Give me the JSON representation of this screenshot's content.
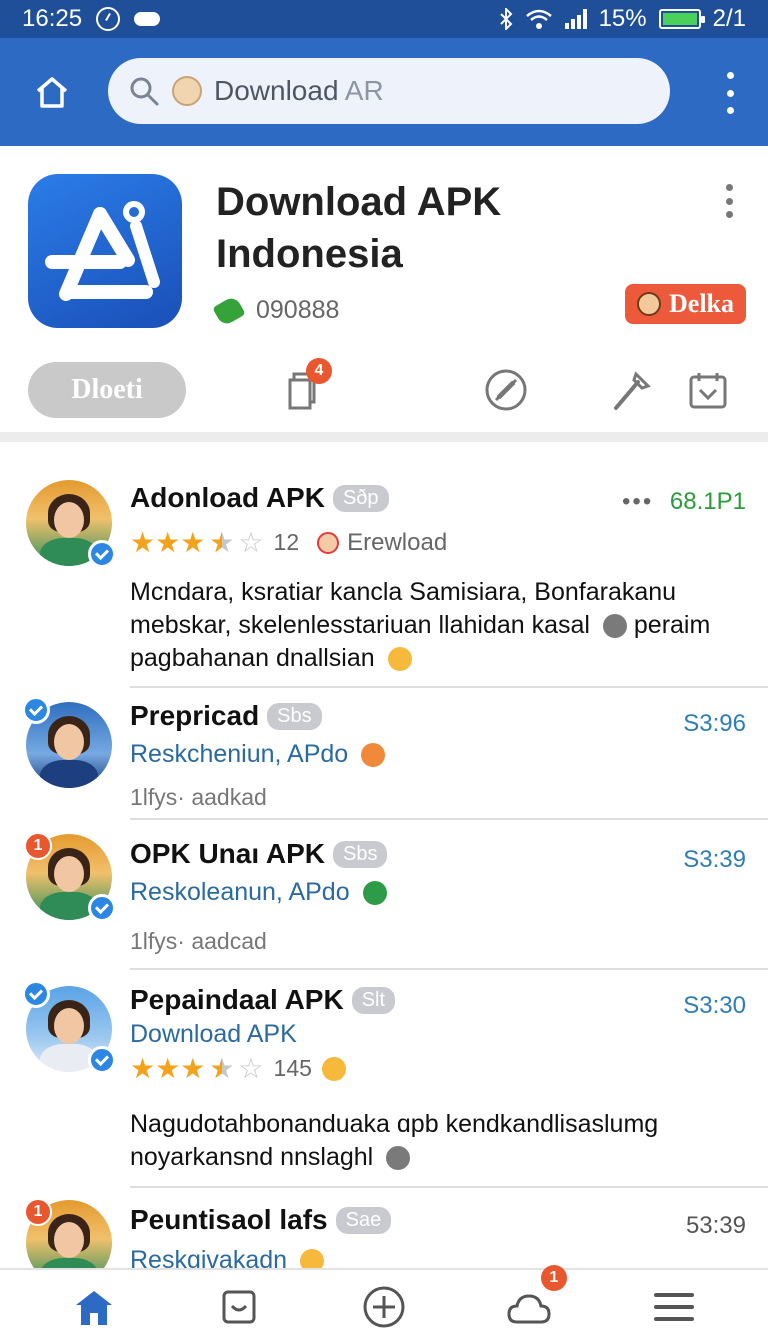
{
  "status_bar": {
    "time": "16:25",
    "battery": "15%",
    "extra": "2/1",
    "battery_color": "#4bd15a"
  },
  "app_bar": {
    "color": "#2d6ac4",
    "search": {
      "query": "Download",
      "suffix": "AR",
      "icon": "search-icon"
    }
  },
  "app": {
    "title": "Download APK Indonesia",
    "downloads": "090888",
    "badge": "Delka",
    "primary_button": "Dloeti",
    "notification_count": "4",
    "logo_color": "#2b7de8"
  },
  "feed": [
    {
      "name": "Adonload APK",
      "tag": "Sðp",
      "time": "68.1P1",
      "rating": 3.5,
      "rating_count": "12",
      "sub_label": "Erewload",
      "body": "Mcndara, ksratiar kancla Samisiara, Bonfarakanu mebskar, skelenlesstariuan llahidan kasal",
      "body_tail": "peraim pagbahanan dnallsian"
    },
    {
      "name": "Prepricad",
      "tag": "Sbs",
      "time": "S3:96",
      "sub": "Reskcheniun, APdo",
      "meta": "1lfys· aadkad"
    },
    {
      "name": "OPK Unaı APK",
      "tag": "Sbs",
      "time": "S3:39",
      "badge_count": "1",
      "sub": "Reskoleanun, APdo",
      "meta": "1lfys· aadcad"
    },
    {
      "name": "Pepaindaal APK",
      "tag": "Slt",
      "time": "S3:30",
      "sub": "Download APK",
      "rating": 3.5,
      "rating_count": "145",
      "body": "Nagudotahbonanduaka ɑpb kendkandlisaslumg noyarkansnd nnslaghl"
    },
    {
      "name": "Peuntisaol lafs",
      "tag": "Sae",
      "time": "53:39",
      "badge_count": "1",
      "sub": "Reskgivakadn"
    }
  ],
  "bottom_nav": {
    "items": [
      "home",
      "inbox",
      "add",
      "notifications",
      "menu"
    ],
    "notification_count": "1"
  }
}
